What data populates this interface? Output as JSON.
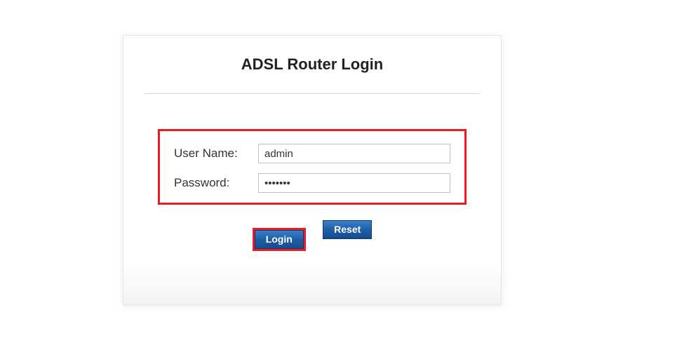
{
  "title": "ADSL Router Login",
  "form": {
    "username_label": "User Name:",
    "username_value": "admin",
    "password_label": "Password:",
    "password_value": "•••••••"
  },
  "buttons": {
    "login": "Login",
    "reset": "Reset"
  }
}
